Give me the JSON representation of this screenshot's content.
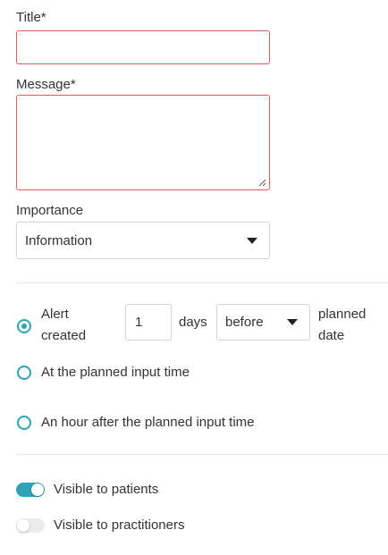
{
  "form": {
    "title_label": "Title*",
    "title_value": "",
    "message_label": "Message*",
    "message_value": "",
    "importance_label": "Importance",
    "importance_value": "Information"
  },
  "timing": {
    "option_alert": {
      "line1": "Alert",
      "line2": "created",
      "checked": true
    },
    "days_value": "1",
    "days_unit": "days",
    "relation_value": "before",
    "suffix_line1": "planned",
    "suffix_line2": "date",
    "option_planned_time": {
      "label": "At the planned input time",
      "checked": false
    },
    "option_hour_after": {
      "label": "An hour after the planned input time",
      "checked": false
    }
  },
  "visibility": {
    "patients": {
      "label": "Visible to patients",
      "on": true
    },
    "practitioners": {
      "label": "Visible to practitioners",
      "on": false
    }
  },
  "colors": {
    "accent": "#2fa3b6",
    "error_border": "#e05a5a"
  }
}
